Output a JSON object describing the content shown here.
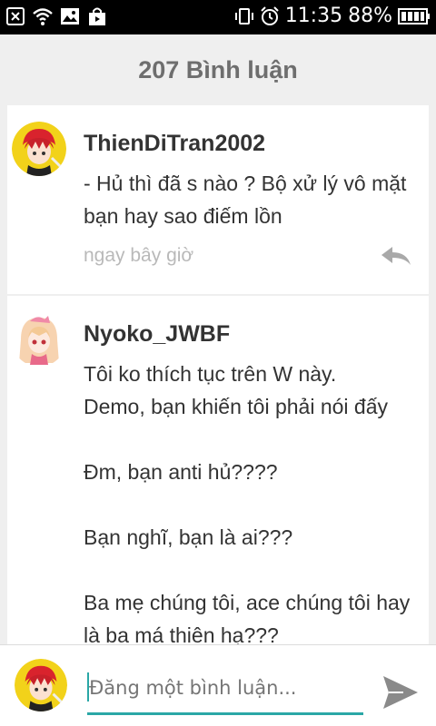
{
  "status_bar": {
    "time": "11:35",
    "battery_pct": "88%",
    "left_icons": [
      "close-notification-icon",
      "wifi-icon",
      "image-notification-icon",
      "shopping-bag-icon"
    ],
    "right_icons": [
      "vibrate-icon",
      "alarm-clock-icon",
      "battery-icon"
    ]
  },
  "header": {
    "title": "207 Bình luận"
  },
  "comments": [
    {
      "username": "ThienDiTran2002",
      "text": "- Hủ thì đã s nào ? Bộ xử lý vô mặt bạn hay sao điếm lồn",
      "time": "ngay bây giờ",
      "reply_icon": "reply-icon"
    },
    {
      "username": "Nyoko_JWBF",
      "text": "Tôi ko thích tục trên W này.\nDemo, bạn khiến tôi phải nói đấy\n\nĐm, bạn anti hủ????\n\nBạn nghĩ, bạn là ai???\n\nBa mẹ chúng tôi, ace chúng tôi hay là ba má thiên hạ???"
    }
  ],
  "footer": {
    "input_placeholder": "Đăng một bình luận...",
    "send_icon": "send-icon",
    "accent": "#2aa7a6"
  }
}
